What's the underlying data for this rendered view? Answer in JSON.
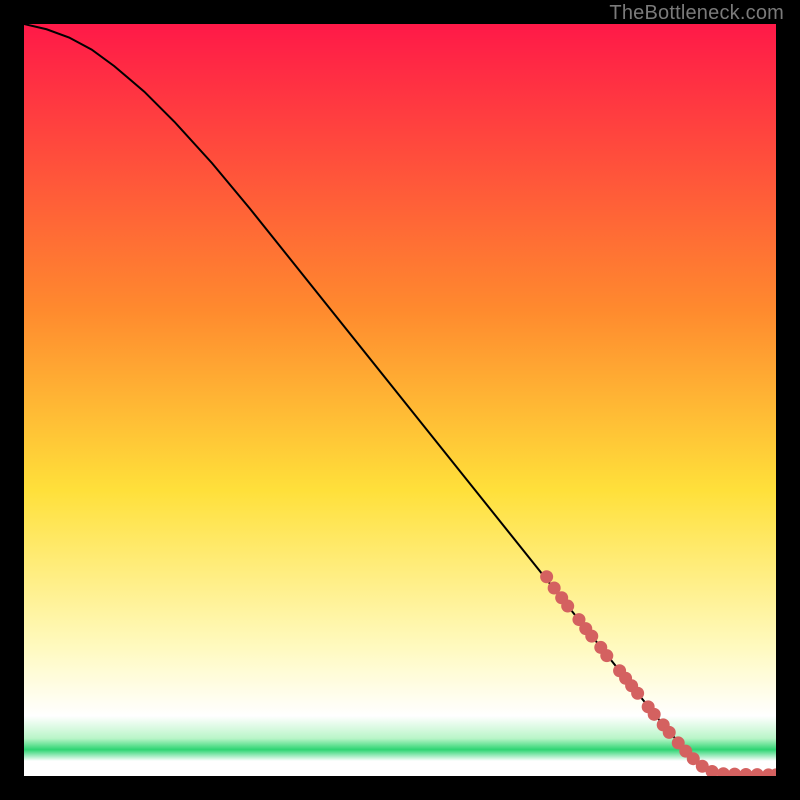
{
  "attribution": "TheBottleneck.com",
  "colors": {
    "black": "#000000",
    "curve": "#000000",
    "dot": "#d46160",
    "grad_top": "#ff1948",
    "grad_mid_upper": "#ff8a2e",
    "grad_mid": "#ffe03a",
    "grad_lower": "#fffac0",
    "grad_green": "#2ed573",
    "grad_bottom_white": "#ffffff"
  },
  "chart_data": {
    "type": "line",
    "title": "",
    "xlabel": "",
    "ylabel": "",
    "xlim": [
      0,
      100
    ],
    "ylim": [
      0,
      100
    ],
    "series": [
      {
        "name": "curve",
        "x": [
          0,
          3,
          6,
          9,
          12,
          16,
          20,
          25,
          30,
          40,
          50,
          60,
          70,
          78,
          82,
          85,
          88,
          90,
          92,
          94,
          96,
          98,
          100
        ],
        "values": [
          100,
          99.3,
          98.2,
          96.6,
          94.4,
          91.0,
          87.0,
          81.5,
          75.5,
          63.0,
          50.5,
          38.0,
          25.5,
          15.5,
          10.5,
          6.8,
          3.4,
          1.5,
          0.6,
          0.3,
          0.2,
          0.15,
          0.15
        ]
      }
    ],
    "dots": [
      {
        "x": 69.5,
        "y": 26.5
      },
      {
        "x": 70.5,
        "y": 25.0
      },
      {
        "x": 71.5,
        "y": 23.7
      },
      {
        "x": 72.3,
        "y": 22.6
      },
      {
        "x": 73.8,
        "y": 20.8
      },
      {
        "x": 74.7,
        "y": 19.6
      },
      {
        "x": 75.5,
        "y": 18.6
      },
      {
        "x": 76.7,
        "y": 17.1
      },
      {
        "x": 77.5,
        "y": 16.0
      },
      {
        "x": 79.2,
        "y": 14.0
      },
      {
        "x": 80.0,
        "y": 13.0
      },
      {
        "x": 80.8,
        "y": 12.0
      },
      {
        "x": 81.6,
        "y": 11.0
      },
      {
        "x": 83.0,
        "y": 9.2
      },
      {
        "x": 83.8,
        "y": 8.2
      },
      {
        "x": 85.0,
        "y": 6.8
      },
      {
        "x": 85.8,
        "y": 5.8
      },
      {
        "x": 87.0,
        "y": 4.4
      },
      {
        "x": 88.0,
        "y": 3.3
      },
      {
        "x": 89.0,
        "y": 2.3
      },
      {
        "x": 90.2,
        "y": 1.3
      },
      {
        "x": 91.5,
        "y": 0.6
      },
      {
        "x": 93.0,
        "y": 0.3
      },
      {
        "x": 94.5,
        "y": 0.25
      },
      {
        "x": 96.0,
        "y": 0.2
      },
      {
        "x": 97.5,
        "y": 0.18
      },
      {
        "x": 99.0,
        "y": 0.15
      },
      {
        "x": 100.0,
        "y": 0.15
      }
    ]
  }
}
